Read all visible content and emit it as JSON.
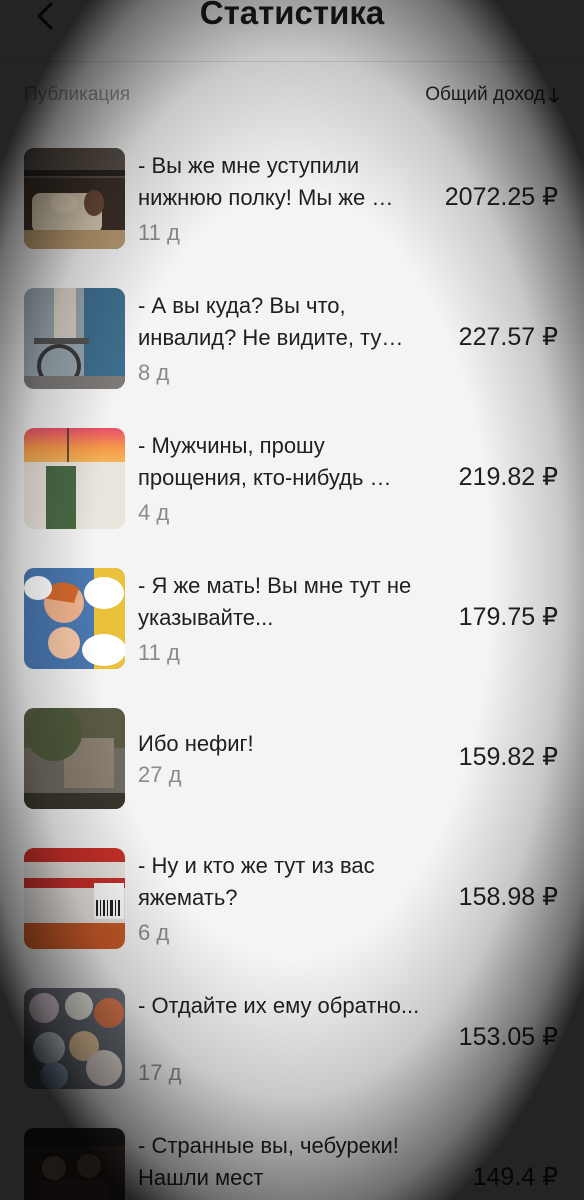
{
  "header": {
    "title": "Статистика",
    "back_icon": "chevron-left-icon"
  },
  "columns": {
    "publication": "Публикация",
    "sort_label": "Общий доход",
    "sort_icon": "arrow-down-icon"
  },
  "rows": [
    {
      "title": "- Вы же мне уступили нижнюю полку! Мы же …",
      "age": "11 д",
      "income": "2072.25 ₽"
    },
    {
      "title": "- А вы куда? Вы что, инвалид? Не видите, ту…",
      "age": "8 д",
      "income": "227.57 ₽"
    },
    {
      "title": "- Мужчины, прошу прощения, кто-нибудь …",
      "age": "4 д",
      "income": "219.82 ₽"
    },
    {
      "title": "- Я же мать! Вы мне тут не указывайте...",
      "age": "11 д",
      "income": "179.75 ₽"
    },
    {
      "title": "Ибо нефиг!",
      "age": "27 д",
      "income": "159.82 ₽"
    },
    {
      "title": "- Ну и кто же тут из вас яжемать?",
      "age": "6 д",
      "income": "158.98 ₽"
    },
    {
      "title": "- Отдайте их ему обратно...",
      "age": "17 д",
      "income": "153.05 ₽"
    },
    {
      "title": "- Странные вы, чебуреки! Нашли мест",
      "age": "",
      "income": "149.4 ₽"
    }
  ]
}
